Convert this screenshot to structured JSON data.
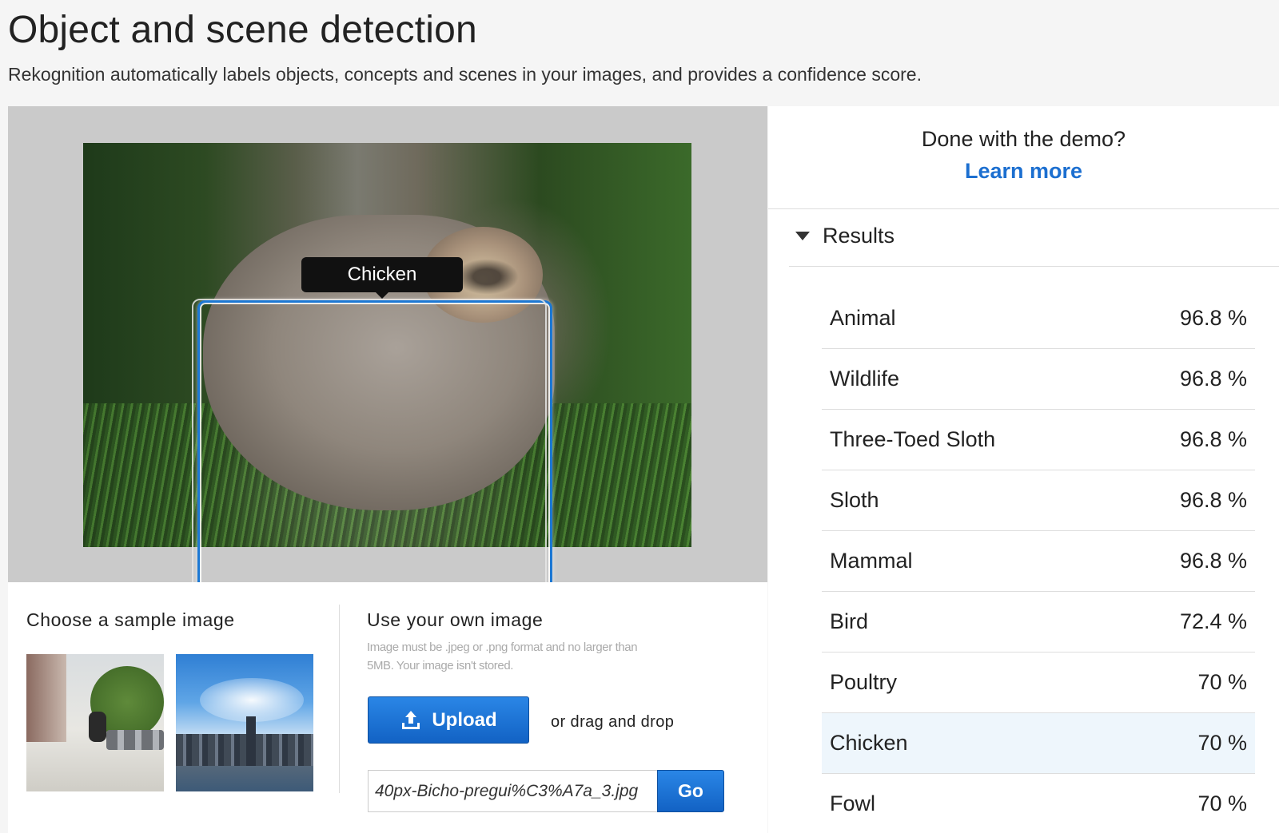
{
  "header": {
    "title": "Object and scene detection",
    "subtitle": "Rekognition automatically labels objects, concepts and scenes in your images, and provides a confidence score."
  },
  "preview": {
    "tooltip_label": "Chicken"
  },
  "samples": {
    "heading": "Choose a sample image"
  },
  "own_image": {
    "heading": "Use your own image",
    "hint": "Image must be .jpeg or .png format and no larger than 5MB. Your image isn't stored.",
    "upload_label": "Upload",
    "drag_text": "or drag and drop",
    "url_value": "40px-Bicho-pregui%C3%A7a_3.jpg",
    "go_label": "Go"
  },
  "sidebar": {
    "done_text": "Done with the demo?",
    "learn_more": "Learn more",
    "results_title": "Results",
    "results": [
      {
        "label": "Animal",
        "value": "96.8 %"
      },
      {
        "label": "Wildlife",
        "value": "96.8 %"
      },
      {
        "label": "Three-Toed Sloth",
        "value": "96.8 %"
      },
      {
        "label": "Sloth",
        "value": "96.8 %"
      },
      {
        "label": "Mammal",
        "value": "96.8 %"
      },
      {
        "label": "Bird",
        "value": "72.4 %"
      },
      {
        "label": "Poultry",
        "value": "70 %"
      },
      {
        "label": "Chicken",
        "value": "70 %"
      },
      {
        "label": "Fowl",
        "value": "70 %"
      }
    ],
    "selected_index": 7
  },
  "colors": {
    "accent": "#1c6fd0",
    "button": "#1a73d6",
    "highlight_row": "#eef6fc"
  },
  "icons": {
    "upload": "upload-icon",
    "caret": "caret-down-icon"
  }
}
